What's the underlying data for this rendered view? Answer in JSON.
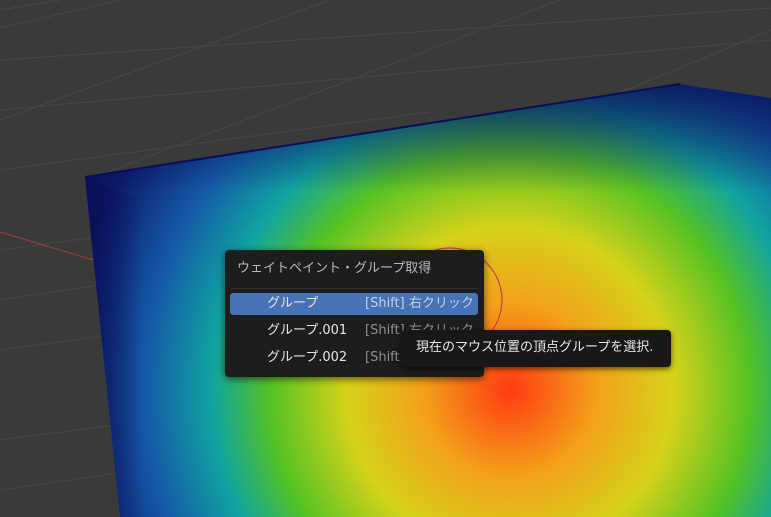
{
  "popup": {
    "title": "ウェイトペイント・グループ取得",
    "items": [
      {
        "label": "グループ",
        "shortcut": "[Shift] 右クリック"
      },
      {
        "label": "グループ.001",
        "shortcut": "[Shift] 右クリック"
      },
      {
        "label": "グループ.002",
        "shortcut": "[Shift] 右クリック"
      }
    ]
  },
  "tooltip": {
    "text": "現在のマウス位置の頂点グループを選択."
  },
  "colors": {
    "viewport_bg": "#3a3a3a",
    "menu_bg": "#1d1d1d",
    "menu_highlight": "#4772b3",
    "brush_circle": "#c8463a"
  }
}
